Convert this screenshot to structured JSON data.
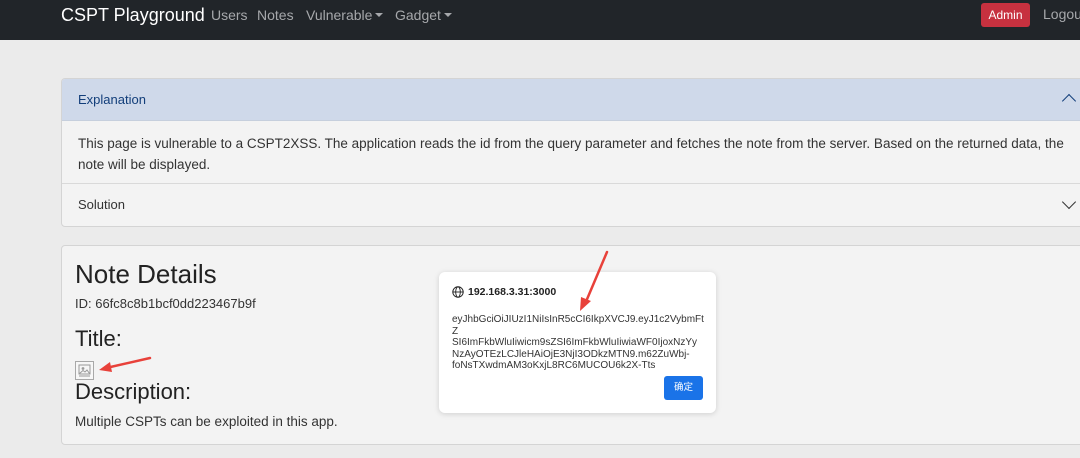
{
  "navbar": {
    "brand": "CSPT Playground",
    "links": [
      "Users",
      "Notes",
      "Vulnerable",
      "Gadget"
    ],
    "admin": "Admin",
    "logout": "Logout"
  },
  "accordion": {
    "explanation_header": "Explanation",
    "explanation_body": "This page is vulnerable to a CSPT2XSS. The application reads the id from the query parameter and fetches the note from the server. Based on the returned data, the note will be displayed.",
    "solution_header": "Solution"
  },
  "note": {
    "heading": "Note Details",
    "id": "ID: 66fc8c8b1bcf0dd223467b9f",
    "title_label": "Title:",
    "description_label": "Description:",
    "description": "Multiple CSPTs can be exploited in this app."
  },
  "dialog": {
    "origin": "192.168.3.31:3000",
    "message": "eyJhbGciOiJIUzI1NiIsInR5cCI6IkpXVCJ9.eyJ1c2VybmFtZ\nSI6ImFkbWluIiwicm9sZSI6ImFkbWluIiwiaWF0IjoxNzYy\nNzAyOTEzLCJleHAiOjE3NjI3ODkzMTN9.m62ZuWbj-\nfoNsTXwdmAM3oKxjL8RC6MUCOU6k2X-Tts",
    "ok": "确定"
  },
  "colors": {
    "navbar_bg": "#212529",
    "admin_bg": "#c7313f",
    "accordion_active_bg": "#cfd9ea",
    "ok_button_bg": "#1a73e8",
    "annotation_arrow": "#e8413a"
  },
  "icons": {
    "dialog_origin": "globe-icon",
    "title_image": "broken-image-icon",
    "accordion_open": "chevron-up-icon",
    "accordion_closed": "chevron-down-icon"
  }
}
